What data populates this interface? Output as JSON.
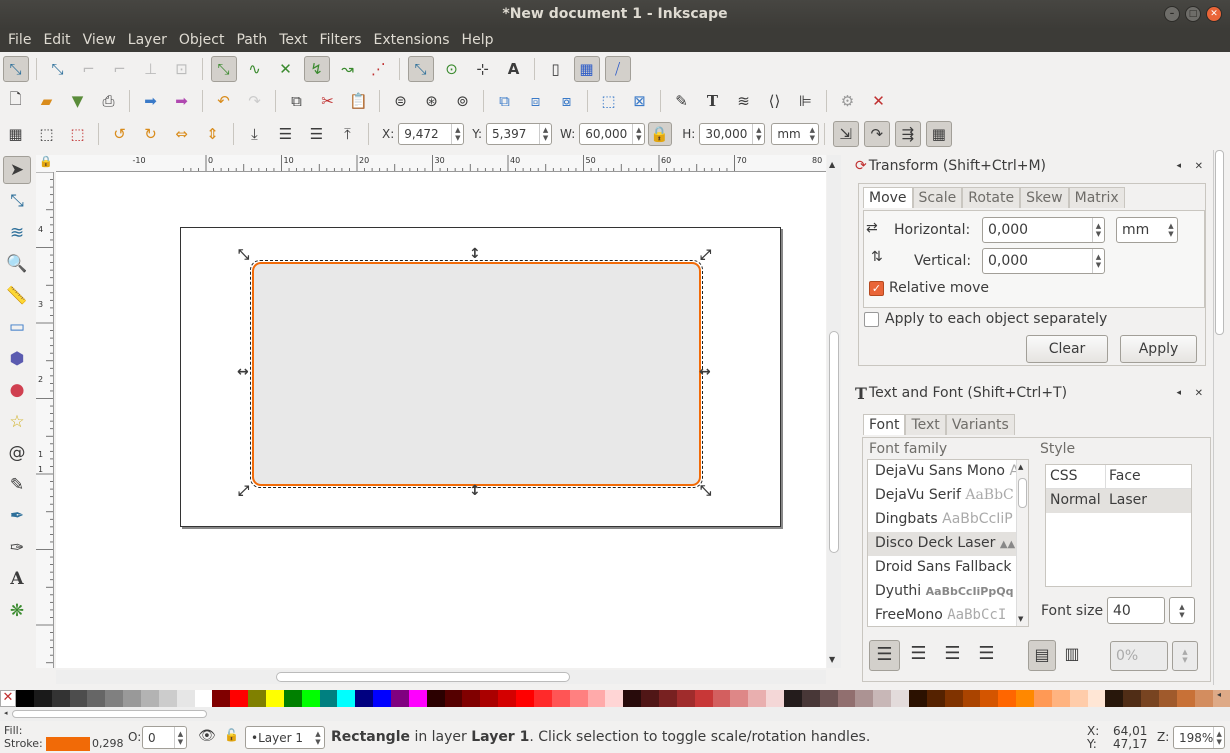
{
  "window": {
    "title": "*New document 1 - Inkscape"
  },
  "menu": [
    "File",
    "Edit",
    "View",
    "Layer",
    "Object",
    "Path",
    "Text",
    "Filters",
    "Extensions",
    "Help"
  ],
  "toolbar3": {
    "x_label": "X:",
    "x": "9,472",
    "y_label": "Y:",
    "y": "5,397",
    "w_label": "W:",
    "w": "60,000",
    "h_label": "H:",
    "h": "30,000",
    "unit": "mm"
  },
  "ruler": {
    "top": [
      "-10",
      "0",
      "10",
      "20",
      "30",
      "40",
      "50",
      "60",
      "70",
      "80"
    ],
    "left": [
      "4",
      "3",
      "2",
      "1",
      "1"
    ]
  },
  "transform": {
    "title": "Transform (Shift+Ctrl+M)",
    "tabs": [
      "Move",
      "Scale",
      "Rotate",
      "Skew",
      "Matrix"
    ],
    "horizontal_label": "Horizontal:",
    "horizontal": "0,000",
    "vertical_label": "Vertical:",
    "vertical": "0,000",
    "unit": "mm",
    "relative_move": "Relative move",
    "apply_each": "Apply to each object separately",
    "clear": "Clear",
    "apply": "Apply"
  },
  "textfont": {
    "title": "Text and Font (Shift+Ctrl+T)",
    "tabs": [
      "Font",
      "Text",
      "Variants"
    ],
    "family_label": "Font family",
    "style_label": "Style",
    "families": [
      {
        "name": "DejaVu Sans Mono",
        "sample": "A"
      },
      {
        "name": "DejaVu Serif",
        "sample": "AaBbC"
      },
      {
        "name": "Dingbats",
        "sample": "AaBbCcIiP"
      },
      {
        "name": "Disco Deck Laser",
        "sample": "▲▲"
      },
      {
        "name": "Droid Sans Fallback",
        "sample": ""
      },
      {
        "name": "Dyuthi",
        "sample": "AaBbCcIiPpQq"
      },
      {
        "name": "FreeMono",
        "sample": "AaBbCcI"
      }
    ],
    "style_cols": [
      "CSS",
      "Face"
    ],
    "style_row": [
      "Normal",
      "Laser"
    ],
    "size_label": "Font size",
    "size": "40",
    "spacing": "0%"
  },
  "status": {
    "fill_label": "Fill:",
    "stroke_label": "Stroke:",
    "stroke_width": "0,298",
    "opacity_label": "O:",
    "opacity": "0",
    "layer": "•Layer 1",
    "msg_bold": "Rectangle",
    "msg1": " in layer ",
    "msg_layer": "Layer 1",
    "msg2": ". Click selection to toggle scale/rotation handles.",
    "x_label": "X:",
    "x": "64,01",
    "y_label": "Y:",
    "y": "47,17",
    "z_label": "Z:",
    "zoom": "198%"
  },
  "colors": {
    "stroke": "#f16a07",
    "selection": "#f16a07",
    "rect_fill": "#e8e8e8"
  }
}
